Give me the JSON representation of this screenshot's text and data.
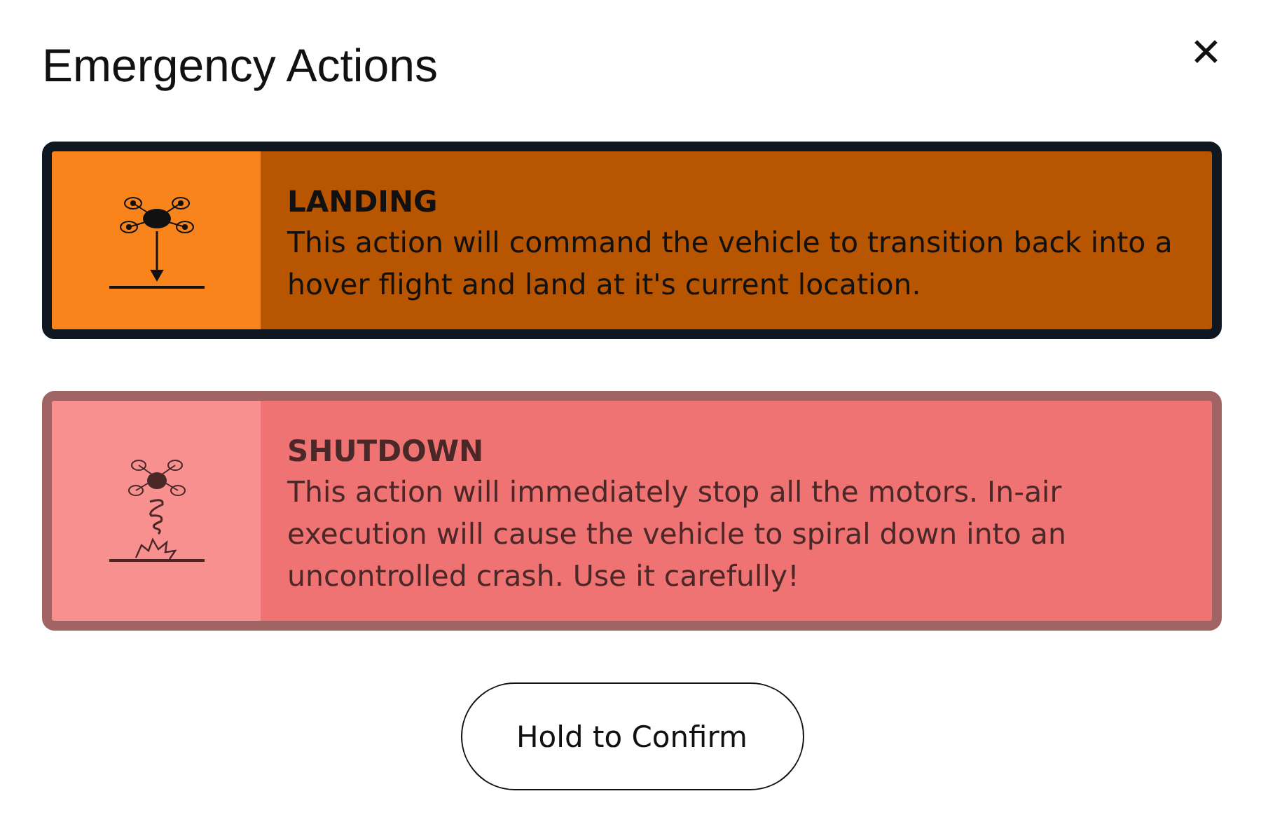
{
  "window": {
    "title": "Emergency Actions",
    "close": "✕"
  },
  "actions": [
    {
      "kind": "landing",
      "title": "LANDING",
      "description": "This action will command the vehicle to transition back into a hover flight and land at it's current location.",
      "selected": true
    },
    {
      "kind": "shutdown",
      "title": "SHUTDOWN",
      "description": "This action will immediately stop all the motors. In-air execution will cause the vehicle to spiral down into an uncontrolled crash. Use it carefully!",
      "selected": false
    }
  ],
  "confirm_button": "Hold to Confirm"
}
